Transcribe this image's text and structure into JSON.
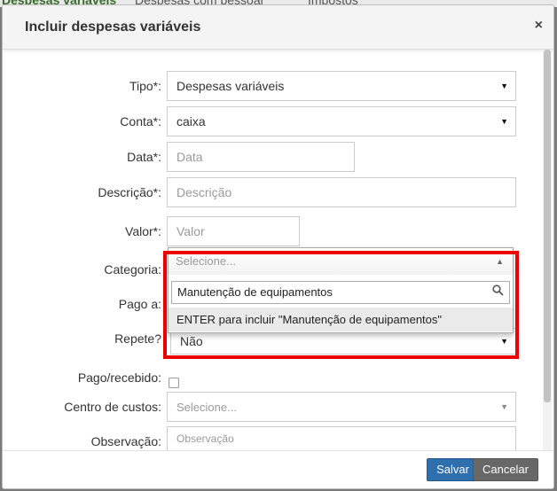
{
  "background_tabs": [
    "Despesas variáveis",
    "Despesas com pessoal",
    "Impostos"
  ],
  "modal": {
    "title": "Incluir despesas variáveis",
    "close_icon": "×"
  },
  "form": {
    "tipo": {
      "label": "Tipo*:",
      "value": "Despesas variáveis"
    },
    "conta": {
      "label": "Conta*:",
      "value": "caixa"
    },
    "data": {
      "label": "Data*:",
      "placeholder": "Data"
    },
    "descricao": {
      "label": "Descrição*:",
      "placeholder": "Descrição"
    },
    "valor": {
      "label": "Valor*:",
      "placeholder": "Valor"
    },
    "categoria": {
      "label": "Categoria:",
      "placeholder": "Selecione..."
    },
    "pago_a": {
      "label": "Pago a:"
    },
    "repete": {
      "label": "Repete?",
      "value": "Não"
    },
    "pago_recebido": {
      "label": "Pago/recebido:",
      "checked": false
    },
    "centro_de_custos": {
      "label": "Centro de custos:",
      "placeholder": "Selecione..."
    },
    "observacao": {
      "label": "Observação:",
      "placeholder": "Observação"
    }
  },
  "category_dropdown": {
    "search_value": "Manutenção de equipamentos",
    "option": "ENTER para incluir \"Manutenção de equipamentos\""
  },
  "footer": {
    "save_label": "Salvar",
    "cancel_label": "Cancelar"
  },
  "colors": {
    "save_button": "#2f6fad",
    "cancel_button": "#686868",
    "highlight_box": "#ee0000"
  }
}
